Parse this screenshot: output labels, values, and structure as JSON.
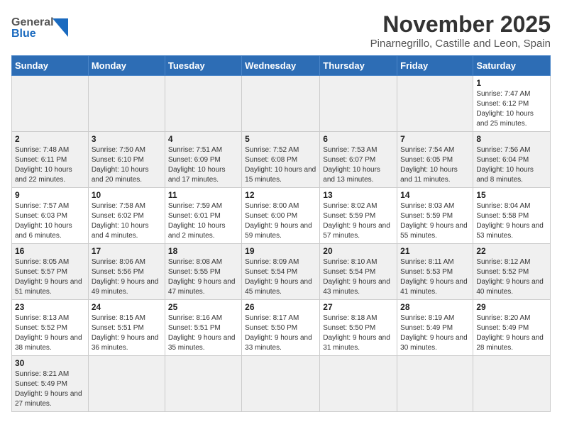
{
  "header": {
    "logo_general": "General",
    "logo_blue": "Blue",
    "month_title": "November 2025",
    "subtitle": "Pinarnegrillo, Castille and Leon, Spain"
  },
  "weekdays": [
    "Sunday",
    "Monday",
    "Tuesday",
    "Wednesday",
    "Thursday",
    "Friday",
    "Saturday"
  ],
  "weeks": [
    [
      {
        "day": "",
        "info": ""
      },
      {
        "day": "",
        "info": ""
      },
      {
        "day": "",
        "info": ""
      },
      {
        "day": "",
        "info": ""
      },
      {
        "day": "",
        "info": ""
      },
      {
        "day": "",
        "info": ""
      },
      {
        "day": "1",
        "info": "Sunrise: 7:47 AM\nSunset: 6:12 PM\nDaylight: 10 hours and 25 minutes."
      }
    ],
    [
      {
        "day": "2",
        "info": "Sunrise: 7:48 AM\nSunset: 6:11 PM\nDaylight: 10 hours and 22 minutes."
      },
      {
        "day": "3",
        "info": "Sunrise: 7:50 AM\nSunset: 6:10 PM\nDaylight: 10 hours and 20 minutes."
      },
      {
        "day": "4",
        "info": "Sunrise: 7:51 AM\nSunset: 6:09 PM\nDaylight: 10 hours and 17 minutes."
      },
      {
        "day": "5",
        "info": "Sunrise: 7:52 AM\nSunset: 6:08 PM\nDaylight: 10 hours and 15 minutes."
      },
      {
        "day": "6",
        "info": "Sunrise: 7:53 AM\nSunset: 6:07 PM\nDaylight: 10 hours and 13 minutes."
      },
      {
        "day": "7",
        "info": "Sunrise: 7:54 AM\nSunset: 6:05 PM\nDaylight: 10 hours and 11 minutes."
      },
      {
        "day": "8",
        "info": "Sunrise: 7:56 AM\nSunset: 6:04 PM\nDaylight: 10 hours and 8 minutes."
      }
    ],
    [
      {
        "day": "9",
        "info": "Sunrise: 7:57 AM\nSunset: 6:03 PM\nDaylight: 10 hours and 6 minutes."
      },
      {
        "day": "10",
        "info": "Sunrise: 7:58 AM\nSunset: 6:02 PM\nDaylight: 10 hours and 4 minutes."
      },
      {
        "day": "11",
        "info": "Sunrise: 7:59 AM\nSunset: 6:01 PM\nDaylight: 10 hours and 2 minutes."
      },
      {
        "day": "12",
        "info": "Sunrise: 8:00 AM\nSunset: 6:00 PM\nDaylight: 9 hours and 59 minutes."
      },
      {
        "day": "13",
        "info": "Sunrise: 8:02 AM\nSunset: 5:59 PM\nDaylight: 9 hours and 57 minutes."
      },
      {
        "day": "14",
        "info": "Sunrise: 8:03 AM\nSunset: 5:59 PM\nDaylight: 9 hours and 55 minutes."
      },
      {
        "day": "15",
        "info": "Sunrise: 8:04 AM\nSunset: 5:58 PM\nDaylight: 9 hours and 53 minutes."
      }
    ],
    [
      {
        "day": "16",
        "info": "Sunrise: 8:05 AM\nSunset: 5:57 PM\nDaylight: 9 hours and 51 minutes."
      },
      {
        "day": "17",
        "info": "Sunrise: 8:06 AM\nSunset: 5:56 PM\nDaylight: 9 hours and 49 minutes."
      },
      {
        "day": "18",
        "info": "Sunrise: 8:08 AM\nSunset: 5:55 PM\nDaylight: 9 hours and 47 minutes."
      },
      {
        "day": "19",
        "info": "Sunrise: 8:09 AM\nSunset: 5:54 PM\nDaylight: 9 hours and 45 minutes."
      },
      {
        "day": "20",
        "info": "Sunrise: 8:10 AM\nSunset: 5:54 PM\nDaylight: 9 hours and 43 minutes."
      },
      {
        "day": "21",
        "info": "Sunrise: 8:11 AM\nSunset: 5:53 PM\nDaylight: 9 hours and 41 minutes."
      },
      {
        "day": "22",
        "info": "Sunrise: 8:12 AM\nSunset: 5:52 PM\nDaylight: 9 hours and 40 minutes."
      }
    ],
    [
      {
        "day": "23",
        "info": "Sunrise: 8:13 AM\nSunset: 5:52 PM\nDaylight: 9 hours and 38 minutes."
      },
      {
        "day": "24",
        "info": "Sunrise: 8:15 AM\nSunset: 5:51 PM\nDaylight: 9 hours and 36 minutes."
      },
      {
        "day": "25",
        "info": "Sunrise: 8:16 AM\nSunset: 5:51 PM\nDaylight: 9 hours and 35 minutes."
      },
      {
        "day": "26",
        "info": "Sunrise: 8:17 AM\nSunset: 5:50 PM\nDaylight: 9 hours and 33 minutes."
      },
      {
        "day": "27",
        "info": "Sunrise: 8:18 AM\nSunset: 5:50 PM\nDaylight: 9 hours and 31 minutes."
      },
      {
        "day": "28",
        "info": "Sunrise: 8:19 AM\nSunset: 5:49 PM\nDaylight: 9 hours and 30 minutes."
      },
      {
        "day": "29",
        "info": "Sunrise: 8:20 AM\nSunset: 5:49 PM\nDaylight: 9 hours and 28 minutes."
      }
    ],
    [
      {
        "day": "30",
        "info": "Sunrise: 8:21 AM\nSunset: 5:49 PM\nDaylight: 9 hours and 27 minutes."
      },
      {
        "day": "",
        "info": ""
      },
      {
        "day": "",
        "info": ""
      },
      {
        "day": "",
        "info": ""
      },
      {
        "day": "",
        "info": ""
      },
      {
        "day": "",
        "info": ""
      },
      {
        "day": "",
        "info": ""
      }
    ]
  ]
}
